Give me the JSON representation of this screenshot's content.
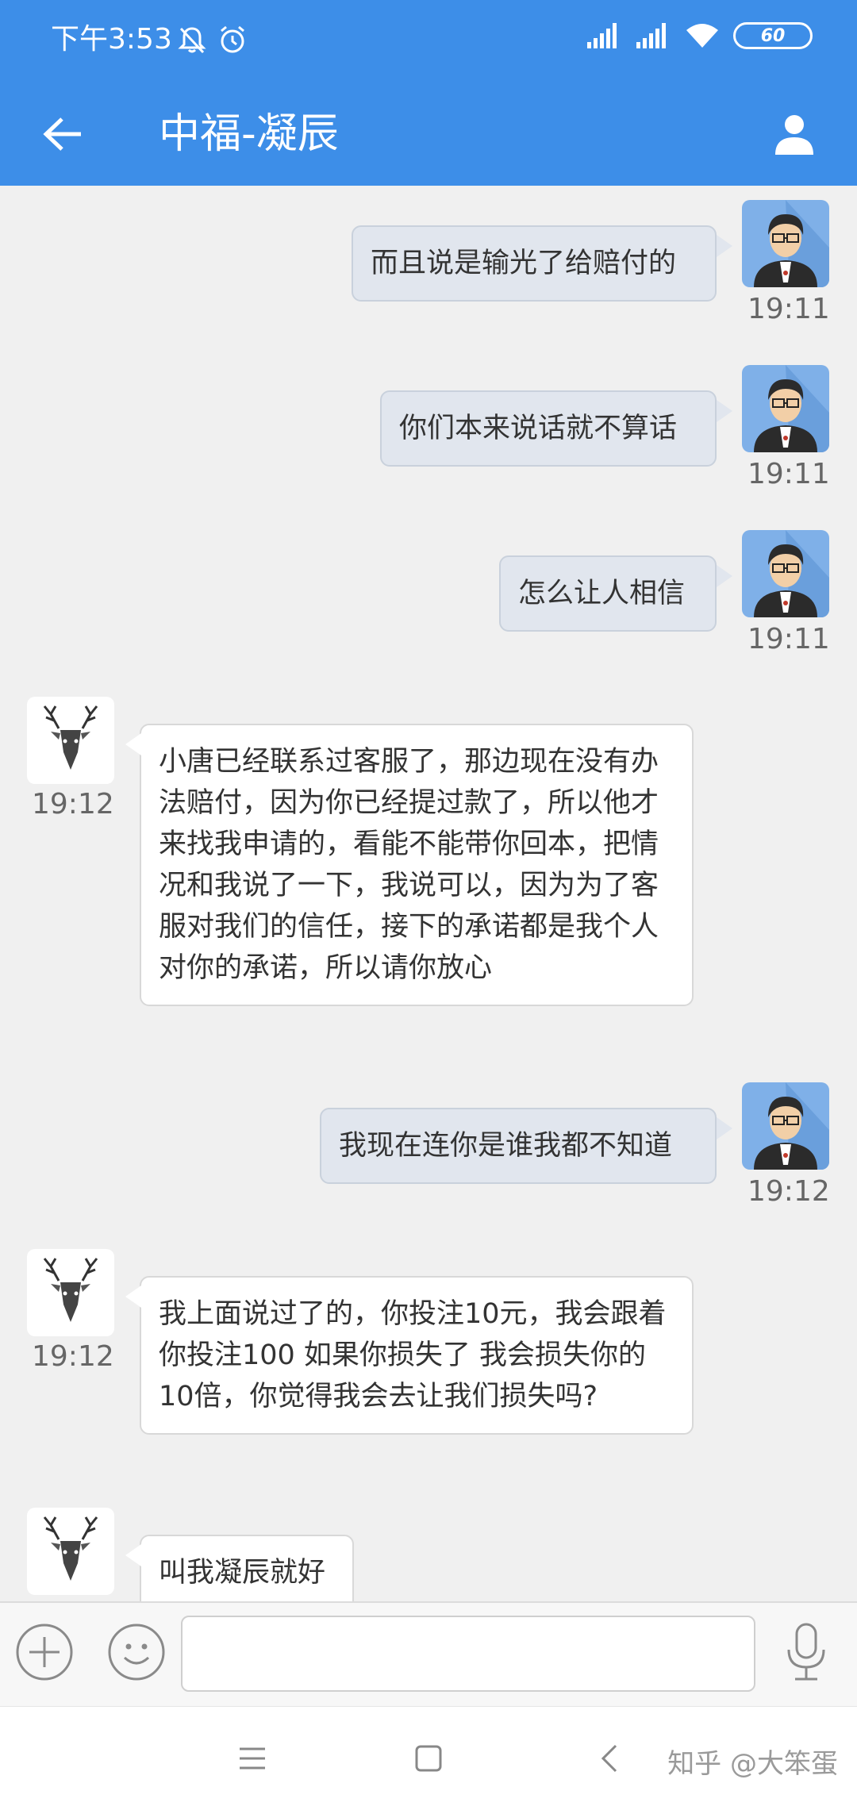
{
  "status_bar": {
    "time": "下午3:53",
    "battery": "60"
  },
  "header": {
    "title": "中福-凝辰"
  },
  "messages": [
    {
      "side": "out",
      "text": "而且说是输光了给赔付的",
      "time": "19:11"
    },
    {
      "side": "out",
      "text": "你们本来说话就不算话",
      "time": "19:11"
    },
    {
      "side": "out",
      "text": "怎么让人相信",
      "time": "19:11"
    },
    {
      "side": "in",
      "text": "小唐已经联系过客服了，那边现在没有办法赔付，因为你已经提过款了，所以他才来找我申请的，看能不能带你回本，把情况和我说了一下，我说可以，因为为了客服对我们的信任，接下的承诺都是我个人对你的承诺，所以请你放心",
      "time": "19:12"
    },
    {
      "side": "out",
      "text": "我现在连你是谁我都不知道",
      "time": "19:12"
    },
    {
      "side": "in",
      "text": "我上面说过了的，你投注10元，我会跟着你投注100  如果你损失了 我会损失你的10倍，你觉得我会去让我们损失吗?",
      "time": "19:12"
    },
    {
      "side": "in",
      "text": "叫我凝辰就好",
      "time": ""
    }
  ],
  "input": {
    "value": "",
    "placeholder": ""
  },
  "watermark": "知乎 @大笨蛋",
  "colors": {
    "header": "#3d8ee8",
    "out_bubble": "#e1e6ee",
    "in_bubble": "#ffffff"
  }
}
